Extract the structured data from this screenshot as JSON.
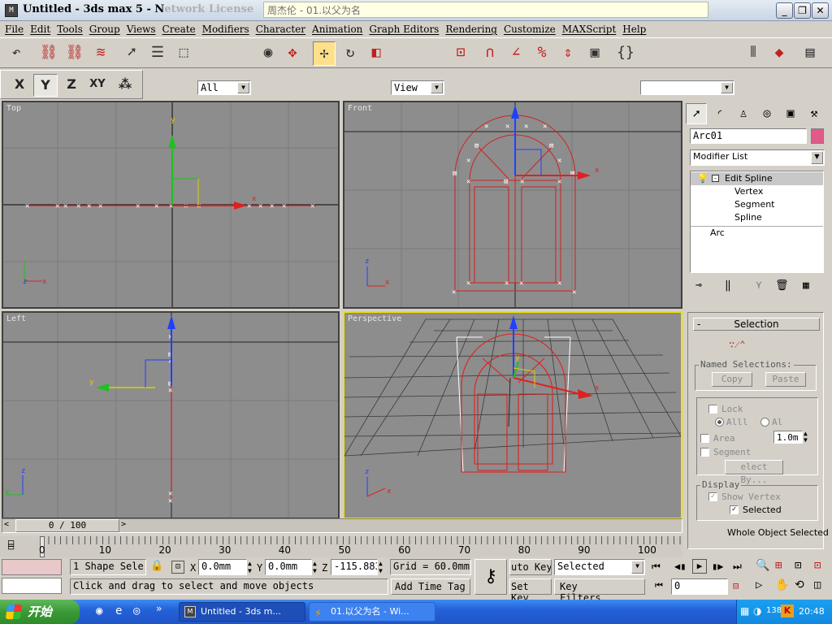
{
  "window": {
    "title_main": "Untitled - 3ds max 5 - N",
    "title_faded": "etwork License",
    "media_tip": "周杰伦 - 01.以父为名"
  },
  "menu": [
    "File",
    "Edit",
    "Tools",
    "Group",
    "Views",
    "Create",
    "Modifiers",
    "Character",
    "Animation",
    "Graph Editors",
    "Rendering",
    "Customize",
    "MAXScript",
    "Help"
  ],
  "toolbar": {
    "selection_filter": "All",
    "ref_coord": "View",
    "named_selection": ""
  },
  "axis_constraints": [
    "X",
    "Y",
    "Z",
    "XY"
  ],
  "viewports": {
    "top": "Top",
    "front": "Front",
    "left": "Left",
    "perspective": "Perspective",
    "axis_labels": {
      "x": "x",
      "y": "y",
      "z": "z"
    }
  },
  "command_panel": {
    "object_name": "Arc01",
    "object_color": "#e05a8a",
    "modifier_list": "Modifier List",
    "stack": {
      "edit_spline": "Edit Spline",
      "vertex": "Vertex",
      "segment": "Segment",
      "spline": "Spline",
      "arc": "Arc"
    },
    "rollout_title": "Selection",
    "rollout_toggle": "-",
    "named_selections": "Named Selections:",
    "copy": "Copy",
    "paste": "Paste",
    "lock": "Lock",
    "alll": "Alll",
    "al": "Al",
    "area": "Area",
    "area_value": "1.0m",
    "segment_chk": "Segment",
    "select_by": "elect By...",
    "display": "Display",
    "show_vertex": "Show Vertex",
    "selected": "Selected",
    "whole_object": "Whole Object Selected"
  },
  "timeline": {
    "frame": "0 / 100",
    "ticks": [
      "0",
      "10",
      "20",
      "30",
      "40",
      "50",
      "60",
      "70",
      "80",
      "90",
      "100"
    ]
  },
  "status": {
    "selection_count": "1 Shape Sele",
    "x_label": "X",
    "x": "0.0mm",
    "y_label": "Y",
    "y": "0.0mm",
    "z_label": "Z",
    "z": "-115.883",
    "grid": "Grid = 60.0mm",
    "prompt": "Click and drag to select and move objects",
    "add_time_tag": "Add Time Tag",
    "auto_key": "uto Key",
    "set_key": "Set Key",
    "selected": "Selected",
    "key_filters": "Key Filters...",
    "current_frame": "0"
  },
  "taskbar": {
    "start": "开始",
    "task1": "Untitled - 3ds m...",
    "task2": "01.以父为名 - Wi...",
    "tray_num": "138",
    "clock": "20:48"
  }
}
